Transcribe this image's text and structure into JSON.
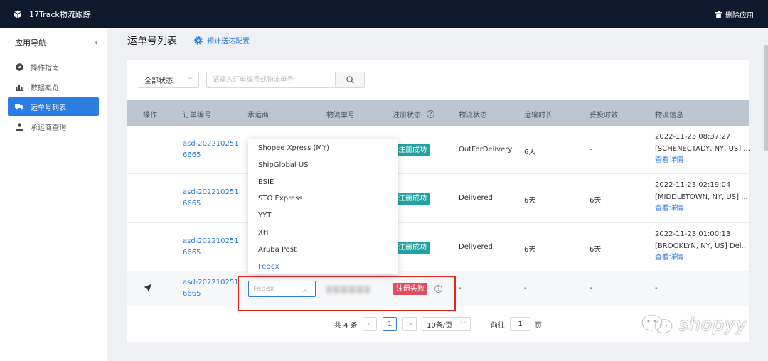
{
  "app": {
    "title": "17Track物流跟踪",
    "delete_label": "删除应用"
  },
  "sidebar": {
    "title": "应用导航",
    "items": [
      {
        "label": "操作指南",
        "icon": "compass-icon"
      },
      {
        "label": "数据概览",
        "icon": "bar-chart-icon"
      },
      {
        "label": "运单号列表",
        "icon": "truck-icon",
        "active": true
      },
      {
        "label": "承运商查询",
        "icon": "user-icon"
      }
    ]
  },
  "page": {
    "title": "运单号列表",
    "eta_config_label": "预计送达配置"
  },
  "filter": {
    "status_value": "全部状态",
    "search_placeholder": "请输入订单编号或物流单号"
  },
  "table": {
    "headers": [
      "操作",
      "订单编号",
      "承运商",
      "物流单号",
      "注册状态",
      "物流状态",
      "运输时长",
      "妥投时效",
      "物流信息"
    ],
    "rows": [
      {
        "order_line1": "asd-202210251",
        "order_line2": "6665",
        "reg_status": "注册成功",
        "logistics_status": "OutForDelivery",
        "transit": "6天",
        "delivery_eff": "-",
        "info_line1": "2022-11-23 08:37:27",
        "info_line2": "[SCHENECTADY, NY, US] ...",
        "info_detail": "查看详情"
      },
      {
        "order_line1": "asd-202210251",
        "order_line2": "6665",
        "reg_status": "注册成功",
        "logistics_status": "Delivered",
        "transit": "6天",
        "delivery_eff": "6天",
        "info_line1": "2022-11-23 02:19:04",
        "info_line2": "[MIDDLETOWN, NY, US] ...",
        "info_detail": "查看详情"
      },
      {
        "order_line1": "asd-202210251",
        "order_line2": "6665",
        "reg_status": "注册成功",
        "logistics_status": "Delivered",
        "transit": "6天",
        "delivery_eff": "6天",
        "info_line1": "2022-11-23 01:00:13",
        "info_line2": "[BROOKLYN, NY, US] Del...",
        "info_detail": "查看详情"
      },
      {
        "order_line1": "asd-202210251",
        "order_line2": "6665",
        "carrier_placeholder": "Fedex",
        "reg_status": "注册失败",
        "logistics_status": "-",
        "transit": "-",
        "delivery_eff": "-",
        "info": "-"
      }
    ]
  },
  "carrier_dropdown": {
    "options": [
      "Shopee Xpress (MY)",
      "ShipGlobal US",
      "BSIE",
      "STO Express",
      "YYT",
      "XH",
      "Aruba Post",
      "Fedex"
    ],
    "selected": "Fedex"
  },
  "pagination": {
    "total": "共 4 条",
    "prev": "<",
    "current_page": "1",
    "next": ">",
    "page_size": "10条/页",
    "goto_label": "前往",
    "goto_value": "1",
    "page_suffix": "页"
  },
  "watermark": {
    "text": "shopyy"
  },
  "colors": {
    "topbar": "#0d1a2e",
    "primary": "#2b7de1",
    "success": "#1fa3a3",
    "danger": "#e04d63",
    "highlight_border": "#e3241b"
  }
}
